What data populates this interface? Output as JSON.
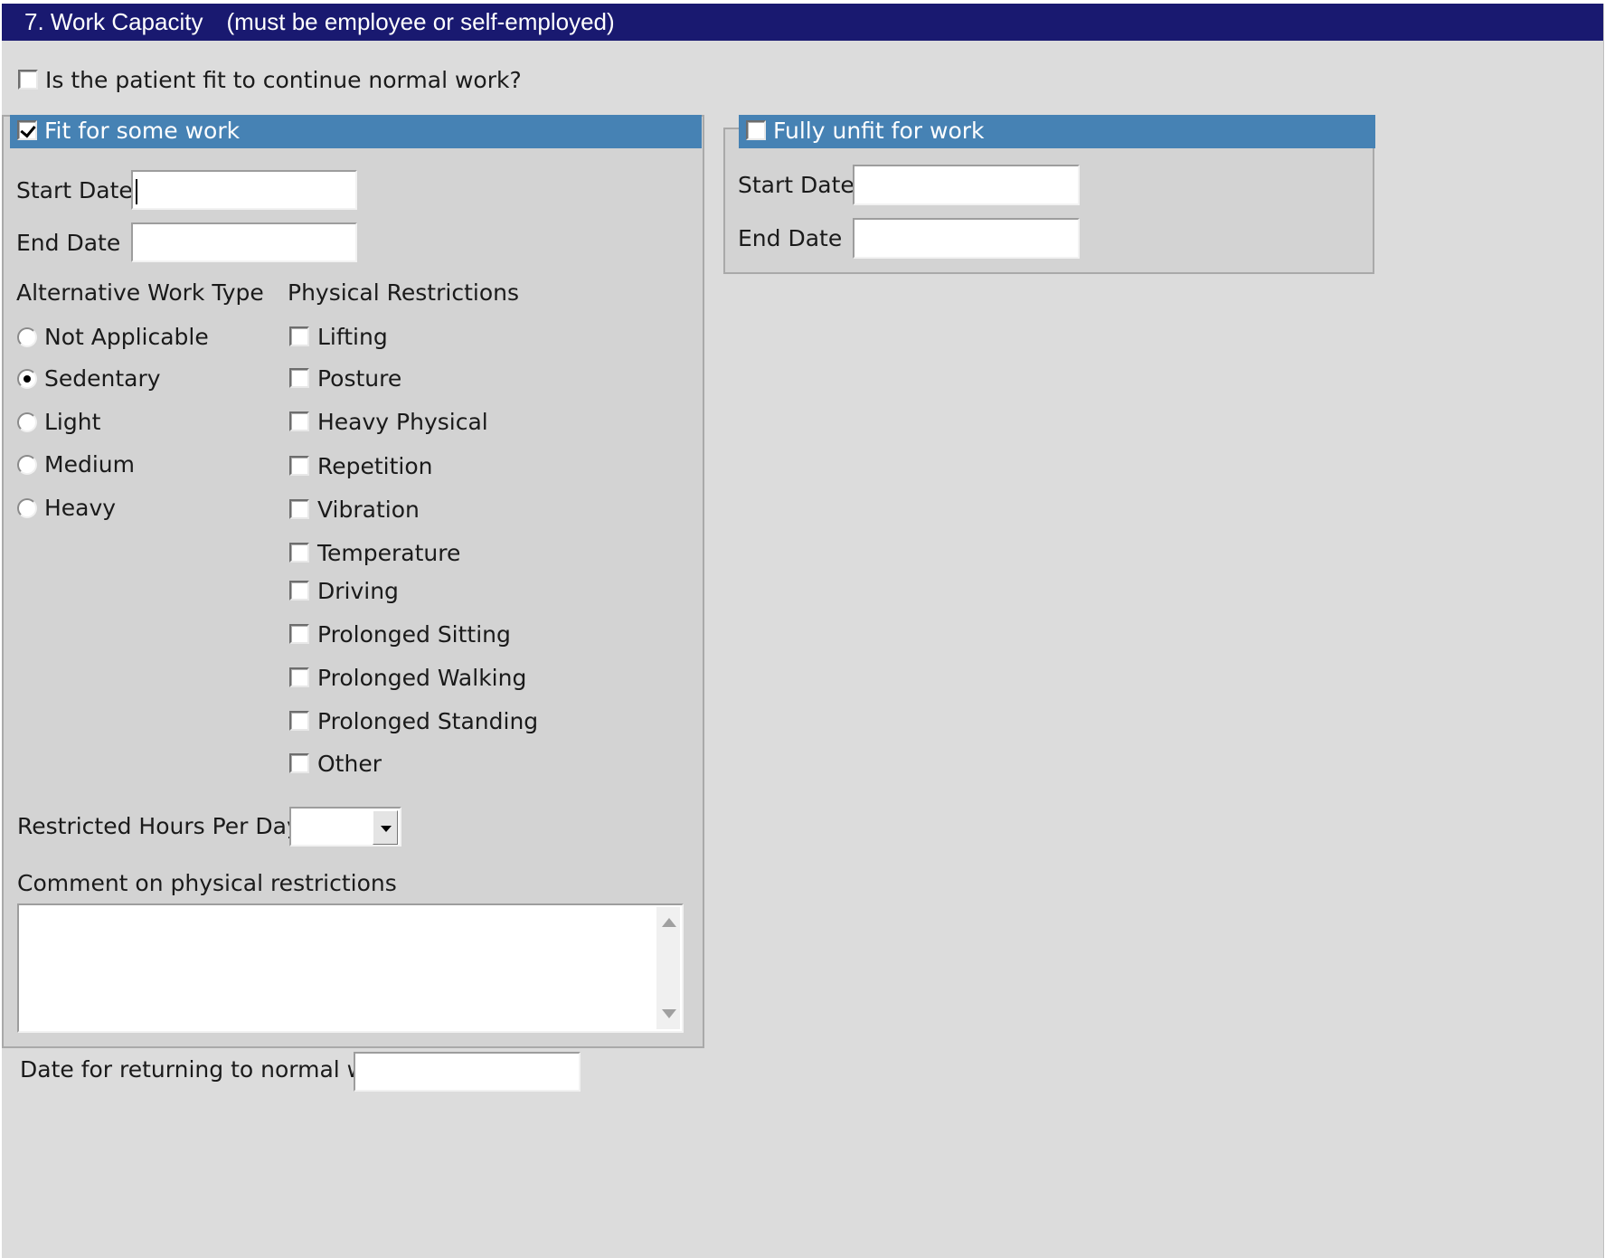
{
  "section": {
    "title": "7. Work Capacity",
    "subtitle": "(must be employee or self-employed)"
  },
  "fit_normal": {
    "label": "Is the patient fit to continue normal work?",
    "checked": false
  },
  "fit_some": {
    "label": "Fit for some work",
    "checked": true,
    "start_date_label": "Start Date",
    "start_date_value": "",
    "end_date_label": "End Date",
    "end_date_value": "",
    "alt_work_type_label": "Alternative Work Type",
    "alt_work_types": [
      {
        "label": "Not Applicable",
        "selected": false
      },
      {
        "label": "Sedentary",
        "selected": true
      },
      {
        "label": "Light",
        "selected": false
      },
      {
        "label": "Medium",
        "selected": false
      },
      {
        "label": "Heavy",
        "selected": false
      }
    ],
    "restrictions_label": "Physical Restrictions",
    "restrictions": [
      {
        "label": "Lifting",
        "checked": false
      },
      {
        "label": "Posture",
        "checked": false
      },
      {
        "label": "Heavy Physical",
        "checked": false
      },
      {
        "label": "Repetition",
        "checked": false
      },
      {
        "label": "Vibration",
        "checked": false
      },
      {
        "label": "Temperature",
        "checked": false
      },
      {
        "label": "Driving",
        "checked": false
      },
      {
        "label": "Prolonged Sitting",
        "checked": false
      },
      {
        "label": "Prolonged Walking",
        "checked": false
      },
      {
        "label": "Prolonged Standing",
        "checked": false
      },
      {
        "label": "Other",
        "checked": false
      }
    ],
    "hours_label": "Restricted Hours Per Day",
    "hours_value": "",
    "comment_label": "Comment on physical restrictions",
    "comment_value": ""
  },
  "fully_unfit": {
    "label": "Fully unfit for work",
    "checked": false,
    "start_date_label": "Start Date",
    "start_date_value": "",
    "end_date_label": "End Date",
    "end_date_value": ""
  },
  "return_date": {
    "label": "Date for returning to normal work",
    "value": ""
  },
  "colors": {
    "title_bar": "#191970",
    "group_header": "#4682b4",
    "panel_bg": "#dcdcdc",
    "group_bg": "#d3d3d3"
  }
}
